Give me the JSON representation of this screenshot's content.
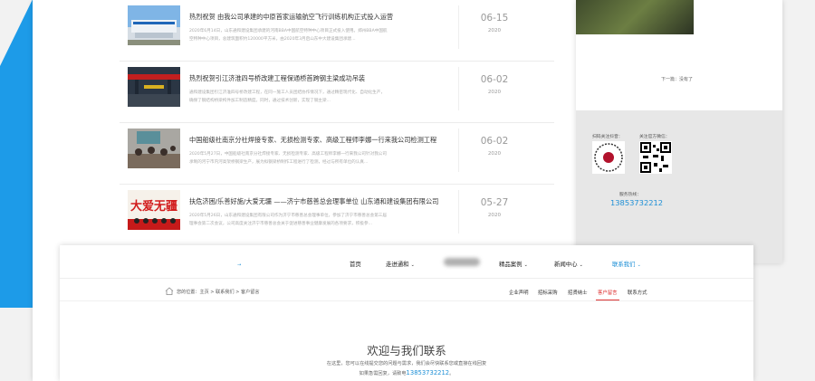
{
  "news": [
    {
      "title": "热烈祝贺 由我公司承建的中原首家运输航空飞行训练机构正式投入运营",
      "summary": "2020年6月14日，山东通和建设集团承建的河南BBA中国航空特种中心项目正式投入使用。郑州BBA中国航空特种中心项目，总建筑面积约120000平方米，由2020年3月启山东中大建设集团承建...",
      "date": "06-15",
      "year": "2020"
    },
    {
      "title": "热烈祝贺引江济淮四号桥改建工程保通桥首跨钢主梁成功吊装",
      "summary": "通和建设集团引江济淮四号桥改建工程，在同一施工人员团结协作情况下，通过精密现代化、自动化生产，确保了钢结构桥梁构件加工制造精度。同时，通过技术创新，实现了钢主梁...",
      "date": "06-02",
      "year": "2020"
    },
    {
      "title": "中国船级社南京分社焊接专家、无损检测专家、高级工程师李娜一行来我公司检测工程",
      "summary": "2020年5月27日，中国船级社南京分社焊接专家、无损检测专家、高级工程师李娜一行来我公司针对我公司承制的河宁市内河高架桥钢梁生产，展为拟钢梁桥制作工程进行了检测，经过与所有单位的认真...",
      "date": "06-02",
      "year": "2020"
    },
    {
      "title": "扶危济困/乐善好施/大爱无疆 ——济宁市慈善总会理事单位 山东通和建设集团有限公司",
      "summary": "2020年5月26日，山东通和建设集团有限公司作为济宁市慈善总会理事单位，参加了济宁市慈善总会第三届理事会第二次会议，公司高度关注济宁市慈善总会关于促进慈善事业健康发展的各项要求，积极参...",
      "date": "05-27",
      "year": "2020"
    }
  ],
  "thumb_banner_text": "大爱无疆",
  "right_panel": {
    "next_nav": "下一篇：没有了",
    "qr_label_left": "扫码关注抖音：",
    "qr_label_right": "关注官方微信：",
    "hotline_label": "服务热线：",
    "hotline": "13853732212"
  },
  "nav": {
    "logo_mark": "→",
    "items": [
      {
        "label": "首页",
        "chevron": false,
        "active": false
      },
      {
        "label": "走进通和",
        "chevron": true,
        "active": false
      },
      {
        "label": "精品案例",
        "chevron": true,
        "active": false
      },
      {
        "label": "新闻中心",
        "chevron": true,
        "active": false
      },
      {
        "label": "联系我们",
        "chevron": true,
        "active": true
      }
    ]
  },
  "breadcrumb": "您的位置：主页 > 联系我们 > 客户留言",
  "subnav": [
    {
      "label": "企业声明",
      "active": false
    },
    {
      "label": "招标采购",
      "active": false
    },
    {
      "label": "招贤纳士",
      "active": false
    },
    {
      "label": "客户留言",
      "active": true
    },
    {
      "label": "联系方式",
      "active": false
    }
  ],
  "welcome": {
    "title": "欢迎与我们联系",
    "desc": "在这里，您可以在线提交您的问题与需求，我们会尽快联系您或直接在线回复",
    "phone_prefix": "如果急需回复，请致电",
    "phone": "13853732212",
    "phone_suffix": "。"
  },
  "colors": {
    "accent": "#1d8fd6",
    "active_sub": "#d33333",
    "wedge": "#1d9be8"
  }
}
